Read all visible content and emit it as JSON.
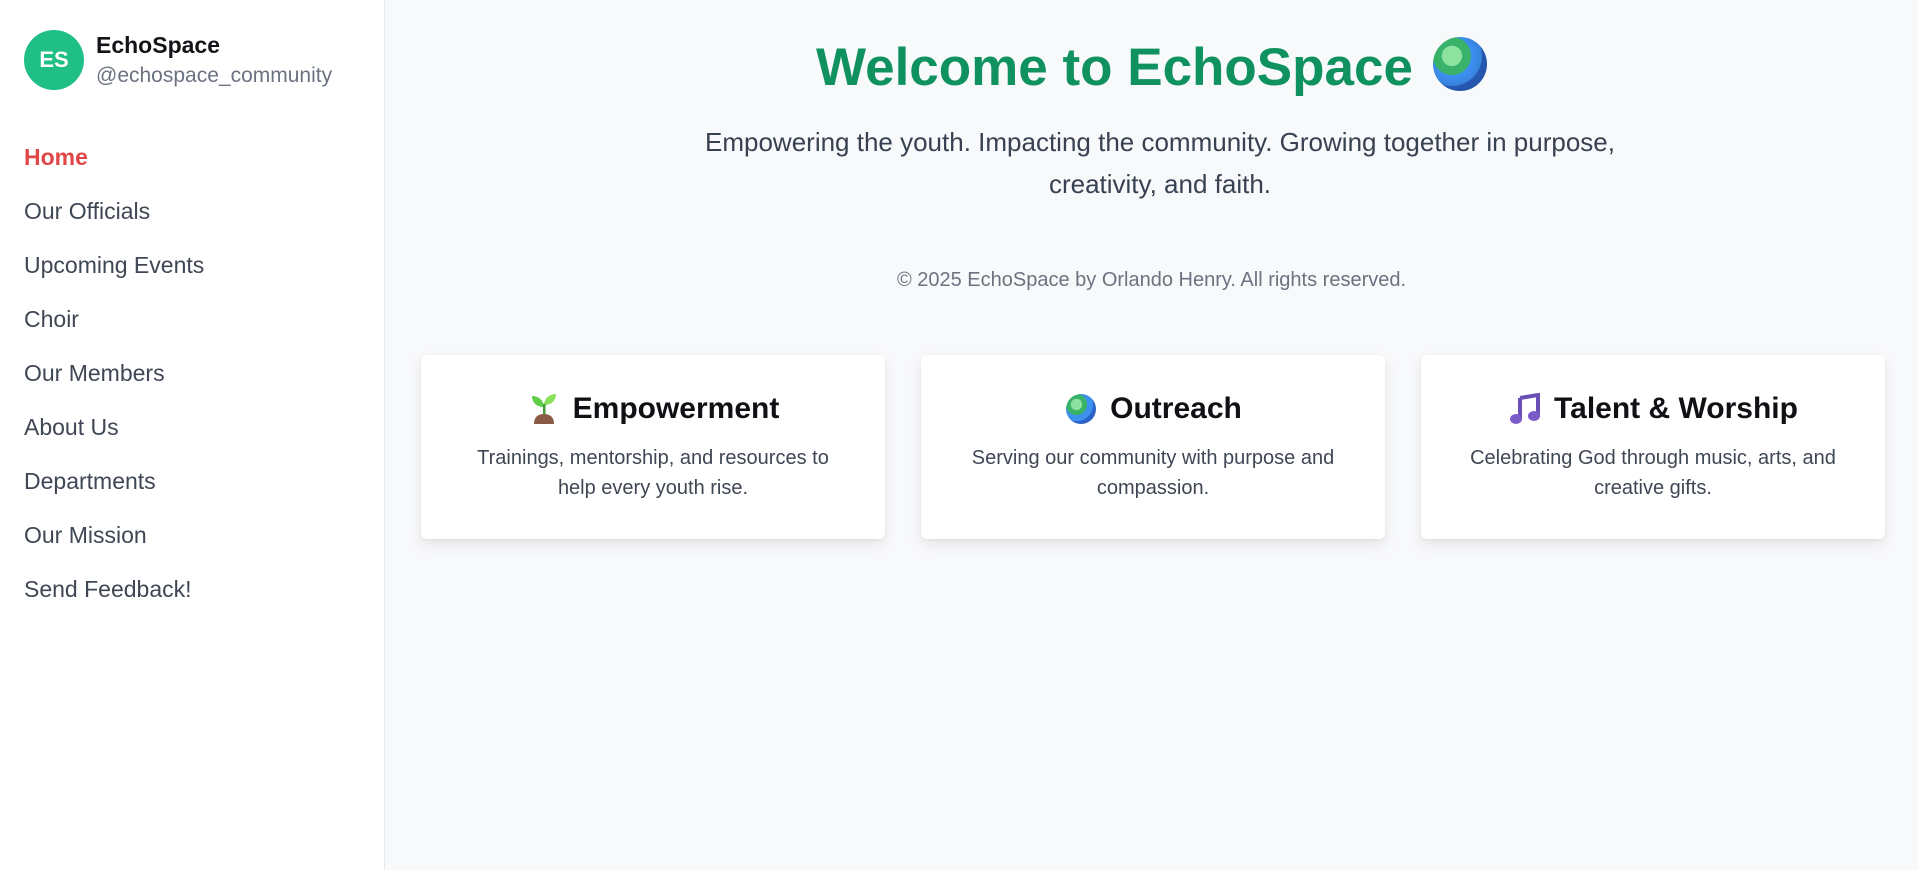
{
  "sidebar": {
    "avatar_initials": "ES",
    "profile_name": "EchoSpace",
    "profile_handle": "@echospace_community",
    "items": [
      {
        "label": "Home",
        "active": true
      },
      {
        "label": "Our Officials"
      },
      {
        "label": "Upcoming Events"
      },
      {
        "label": "Choir"
      },
      {
        "label": "Our Members"
      },
      {
        "label": "About Us"
      },
      {
        "label": "Departments"
      },
      {
        "label": "Our Mission"
      },
      {
        "label": "Send Feedback!"
      }
    ]
  },
  "main": {
    "title": "Welcome to EchoSpace",
    "title_icon": "globe-icon",
    "subtitle": "Empowering the youth. Impacting the community. Growing together in purpose, creativity, and faith.",
    "copyright": "© 2025 EchoSpace by Orlando Henry. All rights reserved.",
    "cards": [
      {
        "icon": "seedling-icon",
        "title": "Empowerment",
        "description": "Trainings, mentorship, and resources to help every youth rise."
      },
      {
        "icon": "globe-icon",
        "title": "Outreach",
        "description": "Serving our community with purpose and compassion."
      },
      {
        "icon": "music-note-icon",
        "title": "Talent & Worship",
        "description": "Celebrating God through music, arts, and creative gifts."
      }
    ]
  },
  "colors": {
    "accent_green": "#0f9160",
    "avatar_green": "#1fbf86",
    "active_nav": "#e14747"
  }
}
